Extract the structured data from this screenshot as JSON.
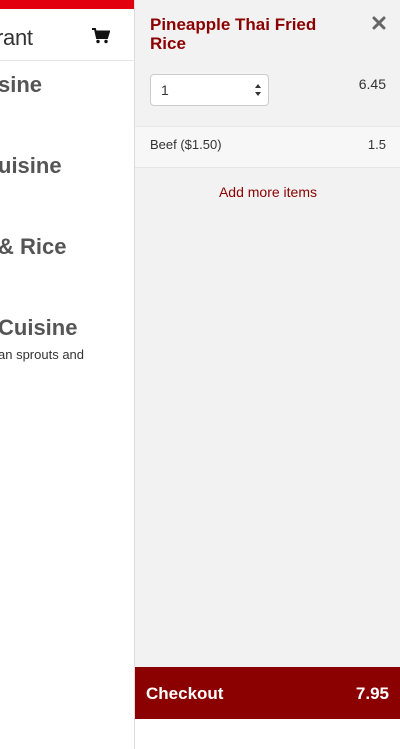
{
  "background_page": {
    "brand_fragment": "rant",
    "cart_icon": "shopping-cart-icon",
    "categories": [
      {
        "label": "sine"
      },
      {
        "label": "uisine"
      },
      {
        "label": "& Rice"
      },
      {
        "label": "Cuisine"
      }
    ],
    "description_fragment": "an sprouts and"
  },
  "cart": {
    "item": {
      "name": "Pineapple Thai Fried Rice",
      "quantity": "1",
      "price": "6.45",
      "close_icon": "close-icon",
      "modifiers": [
        {
          "label": "Beef ($1.50)",
          "price": "1.5"
        }
      ]
    },
    "add_more_label": "Add more items",
    "checkout_label": "Checkout",
    "total": "7.95"
  },
  "colors": {
    "brand_red": "#e2000f",
    "accent_dark_red": "#8b0000",
    "panel_bg": "#f2f2f2"
  }
}
